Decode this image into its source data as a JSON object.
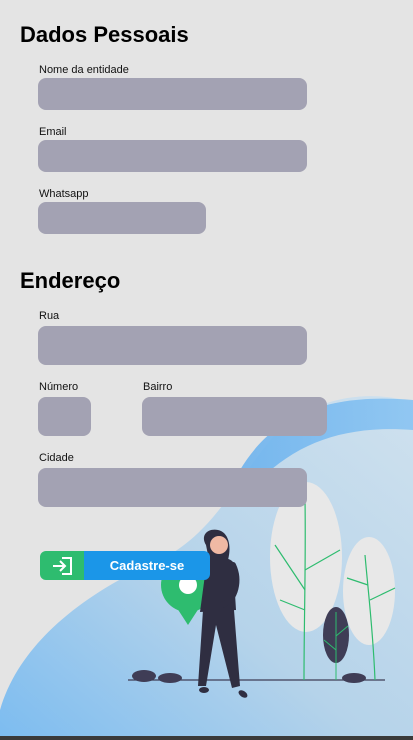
{
  "sections": {
    "personal": {
      "title": "Dados Pessoais",
      "entity_name_label": "Nome da entidade",
      "entity_name_value": "",
      "email_label": "Email",
      "email_value": "",
      "whatsapp_label": "Whatsapp",
      "whatsapp_value": ""
    },
    "address": {
      "title": "Endereço",
      "street_label": "Rua",
      "street_value": "",
      "number_label": "Número",
      "number_value": "",
      "district_label": "Bairro",
      "district_value": "",
      "city_label": "Cidade",
      "city_value": ""
    }
  },
  "submit": {
    "label": "Cadastre-se",
    "icon": "sign-in-icon"
  },
  "colors": {
    "background": "#e4e4e4",
    "field": "#a3a2b3",
    "button_icon_bg": "#2ebc6f",
    "button_bg": "#1b96e8",
    "blob_light": "#a9cff0",
    "blob_dark": "#6db3ee"
  }
}
